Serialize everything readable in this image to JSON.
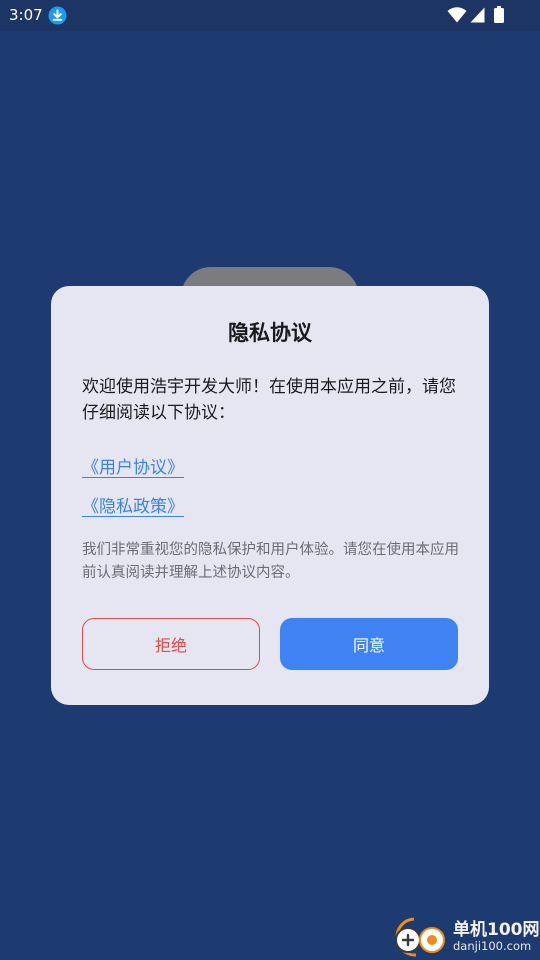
{
  "status_bar": {
    "time": "3:07",
    "icons": [
      "download-icon",
      "wifi-icon",
      "signal-icon",
      "battery-icon"
    ]
  },
  "dialog": {
    "title": "隐私协议",
    "intro": "欢迎使用浩宇开发大师！在使用本应用之前，请您仔细阅读以下协议：",
    "links": {
      "user_agreement": "《用户协议》",
      "privacy_policy": "《隐私政策》"
    },
    "note": "我们非常重视您的隐私保护和用户体验。请您在使用本应用前认真阅读并理解上述协议内容。",
    "buttons": {
      "reject": "拒绝",
      "agree": "同意"
    }
  },
  "watermark": {
    "name": "单机100网",
    "domain": "danji100.com"
  },
  "colors": {
    "background": "#1d3b70",
    "status_bar": "#1c3565",
    "dialog": "#e6e6f2",
    "link": "#3b82e6",
    "reject": "#e44848",
    "agree": "#3f83f3",
    "download_badge": "#1e9bf0"
  }
}
